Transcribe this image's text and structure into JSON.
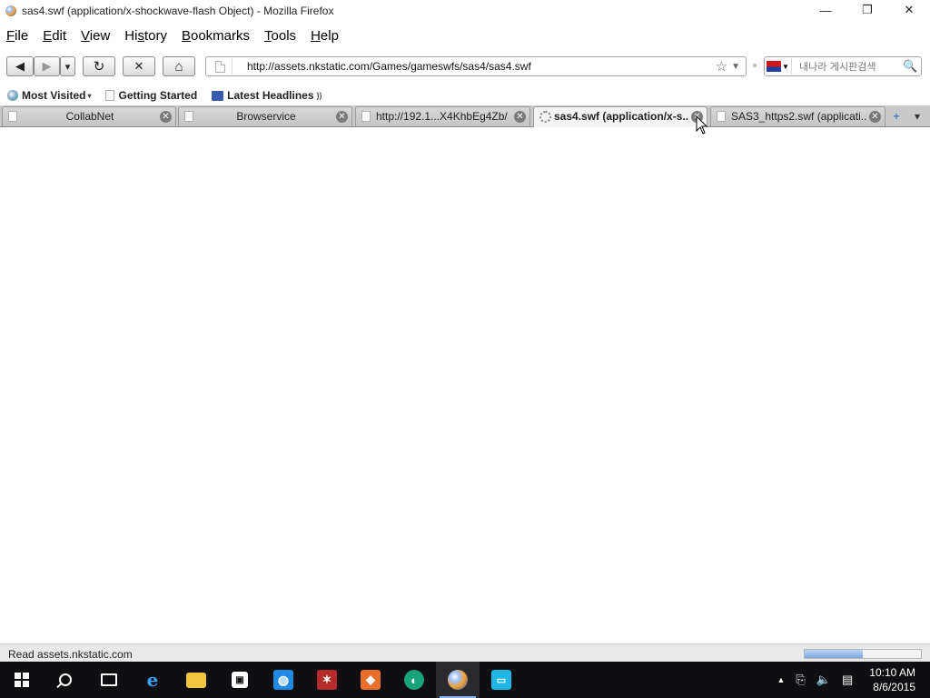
{
  "window": {
    "title": "sas4.swf (application/x-shockwave-flash Object) - Mozilla Firefox",
    "minimize_glyph": "—",
    "maximize_glyph": "❐",
    "close_glyph": "✕"
  },
  "menubar": {
    "items": [
      {
        "accel": "F",
        "rest": "ile"
      },
      {
        "accel": "E",
        "rest": "dit"
      },
      {
        "accel": "V",
        "rest": "iew"
      },
      {
        "accel": "",
        "pre": "Hi",
        "accel2": "s",
        "rest": "tory"
      },
      {
        "accel": "B",
        "rest": "ookmarks"
      },
      {
        "accel": "T",
        "rest": "ools"
      },
      {
        "accel": "H",
        "rest": "elp"
      }
    ]
  },
  "navbar": {
    "back_glyph": "◀",
    "forward_glyph": "▶",
    "history_drop_glyph": "▾",
    "reload_glyph": "↻",
    "stop_glyph": "✕",
    "home_glyph": "⌂",
    "url": "http://assets.nkstatic.com/Games/gameswfs/sas4/sas4.swf",
    "star_glyph": "☆",
    "url_drop_glyph": "▼",
    "search_placeholder": "내나라 게시판검색",
    "search_glyph": "🔍"
  },
  "bookmarks": {
    "items": [
      {
        "label": "Most Visited",
        "icon": "most-visited-icon"
      },
      {
        "label": "Getting Started",
        "icon": "page-icon"
      },
      {
        "label": "Latest Headlines",
        "icon": "rss-icon"
      }
    ],
    "dropdown_glyph": "▾",
    "feed_glyph": "))"
  },
  "tabs": {
    "items": [
      {
        "label": "CollabNet",
        "close": "✕"
      },
      {
        "label": "Browservice",
        "close": "✕"
      },
      {
        "label": "http://192.1...X4KhbEg4Zb/",
        "close": "✕"
      },
      {
        "label": "sas4.swf (application/x-s...",
        "close": "✕",
        "active": true
      },
      {
        "label": "SAS3_https2.swf (applicati...",
        "close": "✕"
      }
    ],
    "new_tab_glyph": "+",
    "list_glyph": "▾"
  },
  "statusbar": {
    "text": "Read assets.nkstatic.com",
    "progress": 0.5
  },
  "taskbar": {
    "tray_up_glyph": "▲",
    "time": "10:10 AM",
    "date": "8/6/2015"
  },
  "colors": {
    "taskbar_bg": "#0f0f12",
    "tab_strip_bg": "#c9c9c9",
    "status_bg": "#e9e9e9"
  }
}
